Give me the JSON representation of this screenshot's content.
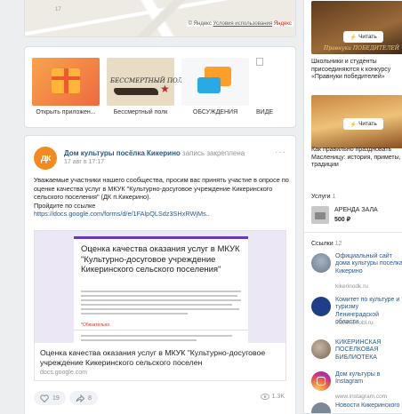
{
  "map": {
    "number": "17",
    "credit_prefix": "©",
    "credit_brand": "Яндекс",
    "credit_link": "Условия использования",
    "credit_logo": "Яндекс"
  },
  "apps": [
    {
      "label": "Открыть приложен..."
    },
    {
      "label": "Бессмертный полк",
      "thumb_text": "БЕССМЕРТНЫЙ ПОЛК"
    },
    {
      "label": "ОБСУЖДЕНИЯ"
    },
    {
      "label": "ВИДЕ"
    }
  ],
  "post": {
    "avatar_text": "дк",
    "author": "Дом культуры посёлка Кикерино",
    "pinned_label": "запись закреплена",
    "time": "17 авг в 17:17",
    "menu": "···",
    "body": "Уважаемые участники нашего сообщества, просим вас принять участие в опросе по оценке качества услуг в МКУК \"Культурно-досуговое учреждение Кикеринского сельского поселения\" (ДК п.Кикерино).",
    "cta": "Пройдите по ссылке",
    "link": "https://docs.google.com/forms/d/e/1FAlpQLSdz3SHxRWjMs..",
    "form_title": "Оценка качества оказания услуг в МКУК \"Культурно-досуговое учреждение Кикеринского сельского поселения\"",
    "form_required": "*Обязательно",
    "preview_title": "Оценка качества оказания услуг в МКУК \"Культурно-досуговое учреждение Кикеринского сельского поселен",
    "preview_domain": "docs.google.com",
    "likes": "19",
    "shares": "8",
    "views": "1.3K"
  },
  "sidebar": {
    "read_label": "Читать",
    "promo1_image_caption": "Правнуки ПОБЕДИТЕЛЕЙ",
    "promo1_text": "Школьники и студенты присоединяются к конкурсу «Правнуки победителей»",
    "promo2_text": "Как правильно праздновать Масленицу: история, приметы, традиции",
    "services_title": "Услуги",
    "services_count": "1",
    "service_name": "АРЕНДА ЗАЛА",
    "service_price": "500 ₽",
    "links_title": "Ссылки",
    "links_count": "12",
    "links": [
      {
        "name": "Официальный сайт дома культуры поселка Кикерино",
        "url": "kikerinodk.ru"
      },
      {
        "name": "Комитет по культуре и туризму Ленинградской области",
        "url": "travel.lenobl.ru"
      },
      {
        "name": "КИКЕРИНСКАЯ ПОСЕЛКОВАЯ БИБЛИОТЕКА",
        "url": ""
      },
      {
        "name": "Дом культуры в Instagram",
        "url": "www.instagram.com"
      },
      {
        "name": "Новости Кикеринского",
        "url": ""
      }
    ]
  },
  "colors": {
    "link": "#2a5885",
    "accent_orange": "#f28a1e",
    "form_purple": "#673ab7"
  }
}
